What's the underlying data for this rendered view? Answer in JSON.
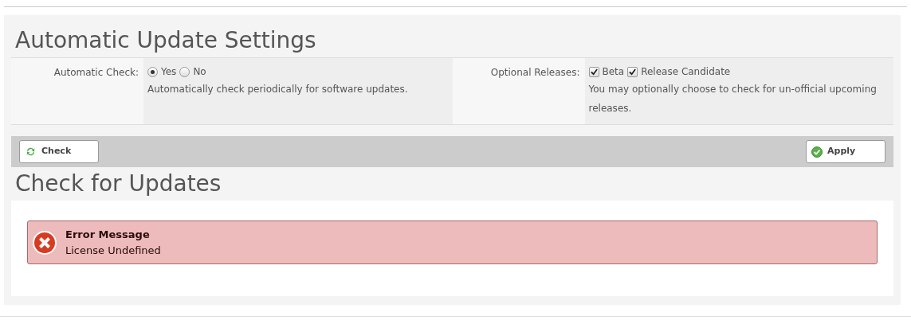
{
  "settings_title": "Automatic Update Settings",
  "settings": [
    {
      "label": "Automatic Check:",
      "kind": "radio",
      "options": [
        {
          "label": "Yes",
          "selected": true
        },
        {
          "label": "No",
          "selected": false
        }
      ],
      "description": "Automatically check periodically for software updates."
    },
    {
      "label": "Optional Releases:",
      "kind": "checkbox",
      "options": [
        {
          "label": "Beta",
          "checked": true
        },
        {
          "label": "Release Candidate",
          "checked": true
        }
      ],
      "description": "You may optionally choose to check for un-official upcoming releases."
    }
  ],
  "toolbar": {
    "check_button": "Check",
    "apply_button": "Apply"
  },
  "updates_title": "Check for Updates",
  "error": {
    "title": "Error Message",
    "message": "License Undefined"
  }
}
